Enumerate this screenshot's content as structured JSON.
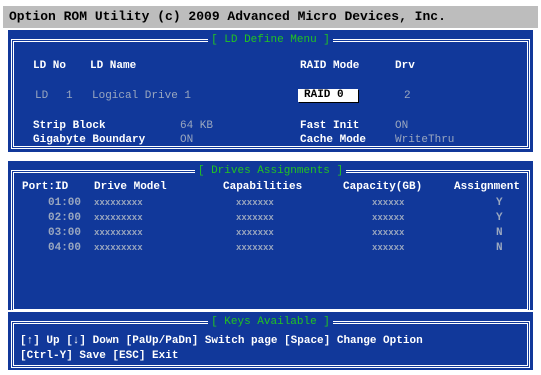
{
  "title": "Option ROM Utility (c) 2009 Advanced Micro Devices, Inc.",
  "ld_define": {
    "header": "[ LD Define Menu ]",
    "col_ld_no": "LD No",
    "col_ld_name": "LD Name",
    "col_raid_mode": "RAID Mode",
    "col_drv": "Drv",
    "ld_label": "LD",
    "ld_number": "1",
    "ld_name": "Logical Drive 1",
    "raid_mode": "RAID 0",
    "drv_count": "2",
    "strip_block_label": "Strip Block",
    "strip_block_value": "64 KB",
    "fast_init_label": "Fast Init",
    "fast_init_value": "ON",
    "gigabyte_boundary_label": "Gigabyte Boundary",
    "gigabyte_boundary_value": "ON",
    "cache_mode_label": "Cache Mode",
    "cache_mode_value": "WriteThru"
  },
  "drives": {
    "header": "[ Drives Assignments ]",
    "columns": [
      "Port:ID",
      "Drive Model",
      "Capabilities",
      "Capacity(GB)",
      "Assignment"
    ],
    "rows": [
      {
        "port": "01:00",
        "model": "xxxxxxxxx",
        "cap": "xxxxxxx",
        "capacity": "xxxxxx",
        "assign": "Y"
      },
      {
        "port": "02:00",
        "model": "xxxxxxxxx",
        "cap": "xxxxxxx",
        "capacity": "xxxxxx",
        "assign": "Y"
      },
      {
        "port": "03:00",
        "model": "xxxxxxxxx",
        "cap": "xxxxxxx",
        "capacity": "xxxxxx",
        "assign": "N"
      },
      {
        "port": "04:00",
        "model": "xxxxxxxxx",
        "cap": "xxxxxxx",
        "capacity": "xxxxxx",
        "assign": "N"
      }
    ]
  },
  "keys": {
    "header": "[ Keys Available ]",
    "line1": "[↑] Up  [↓] Down  [PaUp/PaDn] Switch page  [Space] Change Option",
    "line2": "[Ctrl-Y] Save  [ESC] Exit"
  }
}
